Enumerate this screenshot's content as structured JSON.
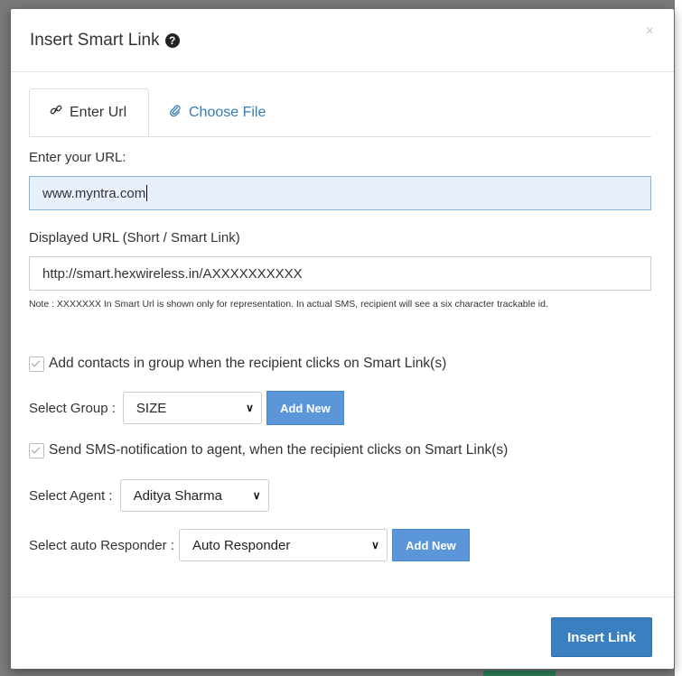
{
  "modal": {
    "title": "Insert Smart Link",
    "help_icon_glyph": "?",
    "close_glyph": "×"
  },
  "tabs": [
    {
      "label": "Enter Url",
      "icon": "link-icon",
      "active": true
    },
    {
      "label": "Choose File",
      "icon": "paperclip-icon",
      "active": false
    }
  ],
  "url_field": {
    "label": "Enter your URL:",
    "value": "www.myntra.com"
  },
  "display_url": {
    "label": "Displayed URL (Short / Smart Link)",
    "value": "http://smart.hexwireless.in/AXXXXXXXXXX"
  },
  "note": "Note : XXXXXXX In Smart Url is shown only for representation. In actual SMS, recipient will see a six character trackable id.",
  "add_contacts": {
    "label": "Add contacts in group when the recipient clicks on Smart Link(s)",
    "checked": true
  },
  "group": {
    "label": "Select Group :",
    "selected": "SIZE",
    "add_new": "Add New"
  },
  "sms_notify": {
    "label": "Send SMS-notification to agent, when the recipient clicks on Smart Link(s)",
    "checked": true
  },
  "agent": {
    "label": "Select Agent :",
    "selected": "Aditya Sharma"
  },
  "responder": {
    "label": "Select auto Responder :",
    "selected": "Auto Responder",
    "add_new": "Add New"
  },
  "footer": {
    "insert_label": "Insert Link"
  },
  "colors": {
    "primary": "#3a80c1",
    "button_light": "#5b97d8",
    "focused_input_bg": "#e8f0fe",
    "link": "#337ab7"
  }
}
